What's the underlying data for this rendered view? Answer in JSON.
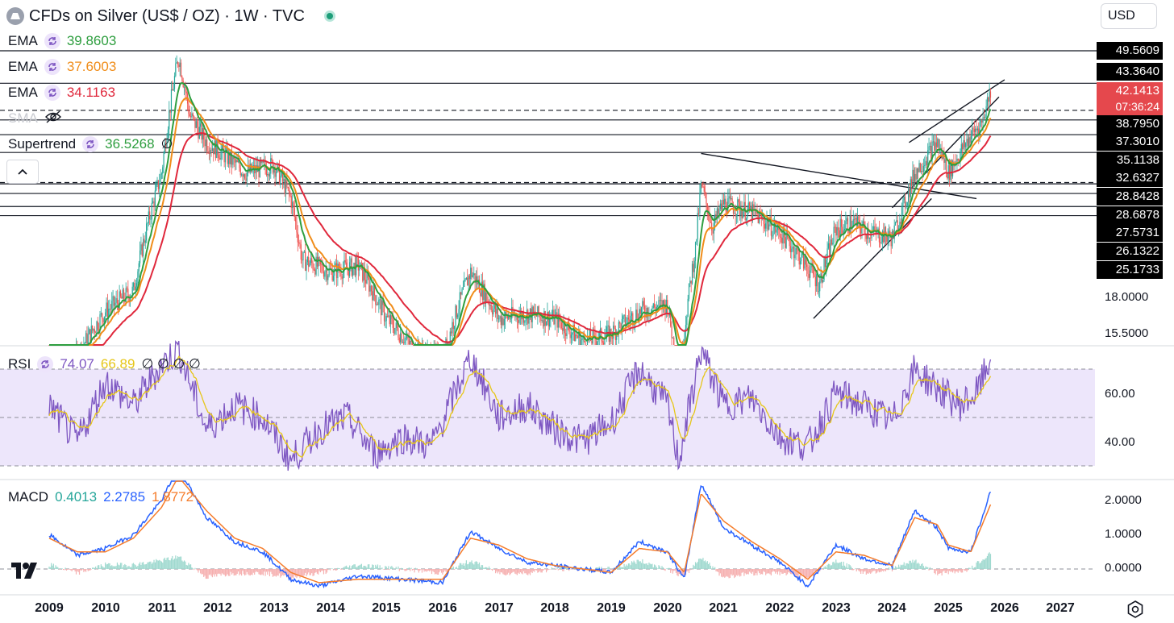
{
  "header": {
    "symbol_title": "CFDs on Silver (US$ / OZ) · 1W · TVC",
    "currency": "USD"
  },
  "indicators": [
    {
      "name": "EMA",
      "value": "39.8603",
      "color": "#2e9e3f"
    },
    {
      "name": "EMA",
      "value": "37.6003",
      "color": "#f08d1a"
    },
    {
      "name": "EMA",
      "value": "34.1163",
      "color": "#e0283c"
    },
    {
      "name": "SMA",
      "value": "",
      "color": "#c9cbd1"
    },
    {
      "name": "Supertrend",
      "value": "36.5268",
      "color": "#2e9e3f",
      "suffix": "∅"
    }
  ],
  "rsi_legend": {
    "name": "RSI",
    "value": "74.07",
    "ma": "66.89",
    "color": "#7e57c2",
    "ma_color": "#e6c619",
    "suffix": "∅ ∅ ∅ ∅"
  },
  "macd_legend": {
    "name": "MACD",
    "hist": "0.4013",
    "macd": "2.2785",
    "signal": "1.8772",
    "hist_color": "#26a69a",
    "macd_color": "#2962ff",
    "signal_color": "#f57c2b"
  },
  "price_axis": {
    "levels": [
      "49.5609",
      "43.3640",
      "38.7950",
      "37.3010",
      "35.1138",
      "32.6327",
      "28.8428",
      "28.6878",
      "27.5731",
      "26.1322",
      "25.1733"
    ],
    "last_price": "42.1413",
    "countdown": "07:36:24",
    "ticks": [
      "18.0000",
      "15.5000"
    ]
  },
  "rsi_axis": {
    "ticks": [
      "60.00",
      "40.00"
    ]
  },
  "macd_axis": {
    "ticks": [
      "2.0000",
      "1.0000",
      "0.0000"
    ]
  },
  "time_axis": [
    "2009",
    "2010",
    "2011",
    "2012",
    "2013",
    "2014",
    "2015",
    "2016",
    "2017",
    "2018",
    "2019",
    "2020",
    "2021",
    "2022",
    "2023",
    "2024",
    "2025",
    "2026",
    "2027"
  ],
  "colors": {
    "up": "#26a69a",
    "down": "#ef5350",
    "ema_fast": "#2e9e3f",
    "ema_mid": "#f08d1a",
    "ema_slow": "#e0283c",
    "rsi_band": "#ede6fb"
  },
  "chart_data": [
    {
      "type": "line",
      "title": "CFDs on Silver (US$ / OZ) · 1W · TVC",
      "x": [
        2009.0,
        2009.5,
        2010.0,
        2010.5,
        2011.0,
        2011.3,
        2011.5,
        2011.8,
        2012.0,
        2012.5,
        2013.0,
        2013.3,
        2013.5,
        2014.0,
        2014.5,
        2015.0,
        2015.5,
        2016.0,
        2016.5,
        2017.0,
        2017.5,
        2018.0,
        2018.5,
        2019.0,
        2019.5,
        2020.0,
        2020.2,
        2020.5,
        2020.6,
        2020.8,
        2021.0,
        2021.5,
        2022.0,
        2022.4,
        2022.7,
        2023.0,
        2023.3,
        2023.6,
        2024.0,
        2024.2,
        2024.4,
        2024.8,
        2025.0,
        2025.4,
        2025.6,
        2025.75
      ],
      "series": [
        {
          "name": "",
          "values": [
            13.0,
            14.2,
            17.0,
            18.5,
            30.0,
            48.5,
            38.0,
            34.0,
            33.0,
            30.0,
            31.0,
            27.0,
            21.0,
            20.0,
            20.5,
            16.5,
            14.5,
            14.0,
            20.0,
            16.5,
            16.8,
            16.5,
            15.0,
            15.5,
            17.0,
            17.5,
            12.5,
            22.0,
            28.5,
            24.0,
            26.5,
            25.5,
            23.5,
            21.0,
            19.0,
            23.8,
            24.5,
            23.5,
            23.0,
            26.0,
            30.0,
            34.0,
            30.0,
            35.0,
            37.0,
            42.14
          ]
        }
      ],
      "ylim": [
        12,
        51
      ],
      "levels": [
        49.5609,
        43.364,
        38.795,
        37.301,
        35.1138,
        32.6327,
        28.8428,
        28.6878,
        27.5731,
        26.1322,
        25.1733
      ]
    },
    {
      "type": "line",
      "x": [
        2009.0,
        2009.5,
        2010.0,
        2010.5,
        2011.0,
        2011.3,
        2011.8,
        2012.3,
        2012.8,
        2013.3,
        2013.8,
        2014.3,
        2014.8,
        2015.3,
        2015.8,
        2016.5,
        2017.0,
        2017.5,
        2018.0,
        2018.5,
        2019.0,
        2019.5,
        2020.0,
        2020.2,
        2020.6,
        2021.0,
        2021.5,
        2022.0,
        2022.5,
        2023.0,
        2023.5,
        2024.0,
        2024.4,
        2024.8,
        2025.2,
        2025.5,
        2025.75
      ],
      "series": [
        {
          "name": "RSI",
          "values": [
            55,
            40,
            65,
            55,
            72,
            78,
            45,
            55,
            50,
            32,
            45,
            50,
            35,
            42,
            38,
            75,
            50,
            55,
            45,
            40,
            48,
            70,
            55,
            32,
            78,
            55,
            58,
            42,
            38,
            60,
            55,
            48,
            70,
            62,
            55,
            60,
            74.07
          ]
        }
      ],
      "ylim": [
        30,
        80
      ],
      "bands": [
        30,
        50,
        70
      ]
    },
    {
      "type": "line",
      "x": [
        2009.0,
        2009.5,
        2010.0,
        2010.5,
        2011.0,
        2011.3,
        2011.8,
        2012.3,
        2012.8,
        2013.3,
        2013.8,
        2014.5,
        2015.3,
        2016.0,
        2016.5,
        2017.0,
        2017.5,
        2018.0,
        2019.0,
        2019.5,
        2020.0,
        2020.3,
        2020.6,
        2021.0,
        2021.5,
        2022.0,
        2022.5,
        2023.0,
        2023.5,
        2024.0,
        2024.4,
        2024.8,
        2025.0,
        2025.4,
        2025.75
      ],
      "series": [
        {
          "name": "MACD",
          "values": [
            1.0,
            0.4,
            0.6,
            1.0,
            2.0,
            3.0,
            1.5,
            0.8,
            0.5,
            -0.3,
            -0.5,
            -0.2,
            -0.3,
            -0.4,
            1.1,
            0.6,
            0.2,
            0.1,
            -0.1,
            0.8,
            0.5,
            -0.3,
            2.5,
            1.2,
            0.7,
            0.2,
            -0.5,
            0.7,
            0.3,
            0.1,
            1.7,
            1.2,
            0.6,
            0.5,
            2.28
          ]
        },
        {
          "name": "Signal",
          "values": [
            0.9,
            0.5,
            0.5,
            0.9,
            1.8,
            2.7,
            1.7,
            0.9,
            0.6,
            -0.1,
            -0.4,
            -0.3,
            -0.3,
            -0.3,
            0.9,
            0.7,
            0.3,
            0.1,
            -0.1,
            0.6,
            0.5,
            -0.1,
            2.2,
            1.4,
            0.8,
            0.3,
            -0.3,
            0.5,
            0.4,
            0.1,
            1.5,
            1.3,
            0.7,
            0.5,
            1.88
          ]
        }
      ],
      "ylim": [
        -0.5,
        2.6
      ]
    }
  ]
}
